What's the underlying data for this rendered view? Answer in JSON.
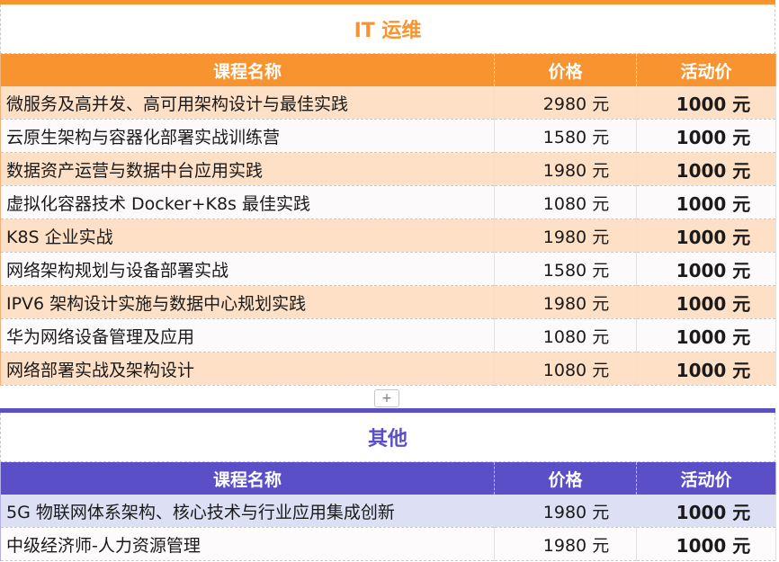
{
  "sections": [
    {
      "title": "IT 运维",
      "headers": {
        "name": "课程名称",
        "price": "价格",
        "promo": "活动价"
      },
      "rows": [
        {
          "name": "微服务及高并发、高可用架构设计与最佳实践",
          "price": "2980 元",
          "promo": "1000 元"
        },
        {
          "name": "云原生架构与容器化部署实战训练营",
          "price": "1580 元",
          "promo": "1000 元"
        },
        {
          "name": "数据资产运营与数据中台应用实践",
          "price": "1980 元",
          "promo": "1000 元"
        },
        {
          "name": "虚拟化容器技术 Docker+K8s 最佳实践",
          "price": "1080 元",
          "promo": "1000 元"
        },
        {
          "name": "K8S 企业实战",
          "price": "1980 元",
          "promo": "1000 元"
        },
        {
          "name": "网络架构规划与设备部署实战",
          "price": "1580 元",
          "promo": "1000 元"
        },
        {
          "name": "IPV6 架构设计实施与数据中心规划实践",
          "price": "1980 元",
          "promo": "1000 元"
        },
        {
          "name": "华为网络设备管理及应用",
          "price": "1080 元",
          "promo": "1000 元"
        },
        {
          "name": "网络部署实战及架构设计",
          "price": "1080 元",
          "promo": "1000 元"
        }
      ]
    },
    {
      "title": "其他",
      "headers": {
        "name": "课程名称",
        "price": "价格",
        "promo": "活动价"
      },
      "rows": [
        {
          "name": "5G 物联网体系架构、核心技术与行业应用集成创新",
          "price": "1980 元",
          "promo": "1000 元"
        },
        {
          "name": "中级经济师-人力资源管理",
          "price": "1980 元",
          "promo": "1000 元"
        }
      ]
    }
  ],
  "add_button": {
    "label": "+"
  },
  "colors": {
    "it_accent": "#f7942f",
    "other_accent": "#5a4fc6"
  }
}
